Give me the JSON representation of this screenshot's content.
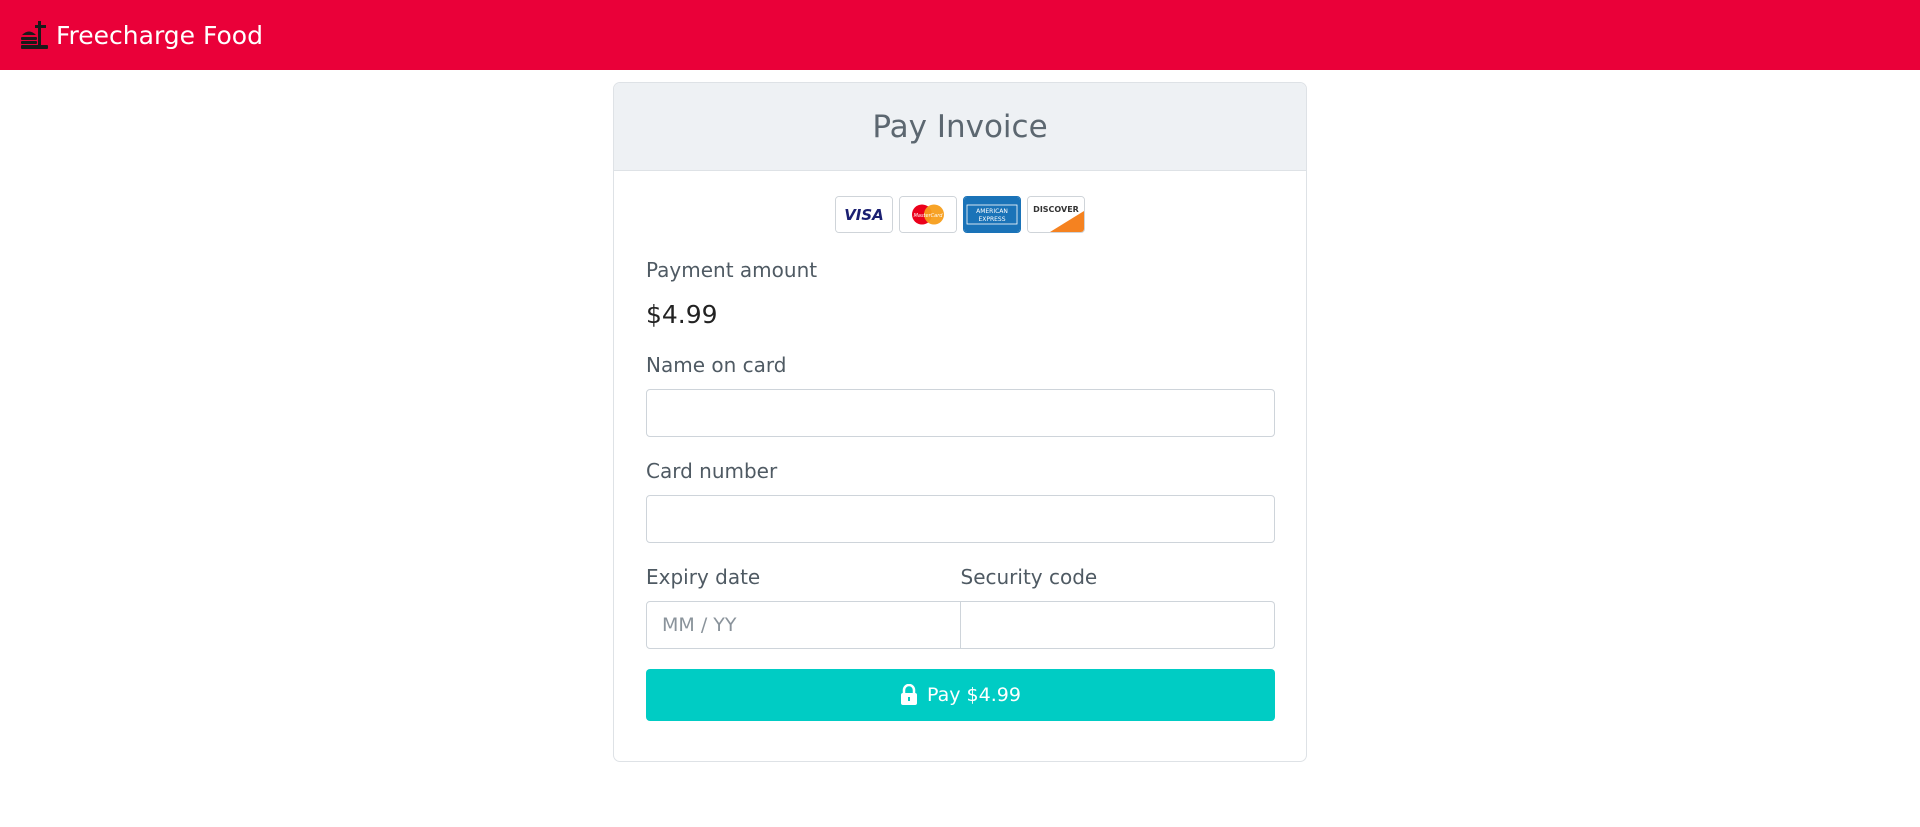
{
  "navbar": {
    "brand": "Freecharge Food",
    "brand_icon": "food-icon",
    "background_color": "#ea0039"
  },
  "invoice": {
    "title": "Pay Invoice",
    "card_logos": [
      {
        "name": "visa-logo",
        "text": "VISA"
      },
      {
        "name": "mastercard-logo",
        "text": "MasterCard"
      },
      {
        "name": "amex-logo",
        "text": "AMERICAN EXPRESS"
      },
      {
        "name": "discover-logo",
        "text": "DISCOVER"
      }
    ],
    "payment_amount_label": "Payment amount",
    "payment_amount": "$4.99",
    "name_label": "Name on card",
    "name_value": "",
    "card_number_label": "Card number",
    "card_number_value": "",
    "expiry_label": "Expiry date",
    "expiry_placeholder": "MM / YY",
    "security_label": "Security code",
    "security_value": "",
    "pay_button_label": "Pay $4.99",
    "pay_button_icon": "lock-icon",
    "pay_button_color": "#00ccc4"
  }
}
